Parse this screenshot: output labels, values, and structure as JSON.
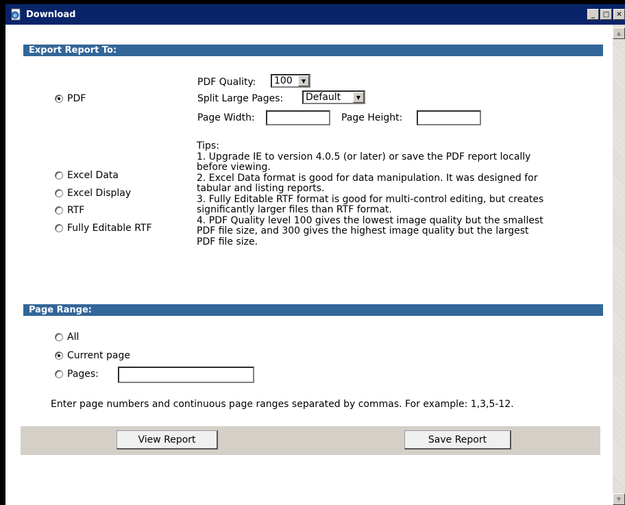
{
  "window": {
    "title": "Download"
  },
  "export": {
    "heading": "Export Report To:",
    "formats": [
      {
        "label": "PDF",
        "checked": true
      },
      {
        "label": "Excel Data",
        "checked": false
      },
      {
        "label": "Excel Display",
        "checked": false
      },
      {
        "label": "RTF",
        "checked": false
      },
      {
        "label": "Fully Editable RTF",
        "checked": false
      }
    ],
    "pdf_quality_label": "PDF Quality:",
    "pdf_quality_value": "100",
    "split_large_pages_label": "Split Large Pages:",
    "split_large_pages_value": "Default",
    "page_width_label": "Page Width:",
    "page_height_label": "Page Height:",
    "tips": [
      "Tips:",
      "1. Upgrade IE to version 4.0.5 (or later) or save the PDF report locally",
      "before viewing.",
      "2. Excel Data format is good for data manipulation. It was designed for",
      "tabular and listing reports.",
      "3. Fully Editable RTF format is good for multi-control editing, but creates",
      "significantly larger files than RTF format.",
      "4. PDF Quality level 100 gives the lowest image quality but the smallest",
      "PDF file size, and 300 gives the highest image quality but the largest",
      "PDF file size."
    ]
  },
  "page_range": {
    "heading": "Page Range:",
    "options": [
      {
        "label": "All",
        "checked": false
      },
      {
        "label": "Current page",
        "checked": true
      },
      {
        "label": "Pages:",
        "checked": false
      }
    ],
    "note": "Enter page numbers and continuous page ranges separated by commas. For example: 1,3,5-12."
  },
  "buttons": {
    "view": "View Report",
    "save": "Save Report"
  }
}
